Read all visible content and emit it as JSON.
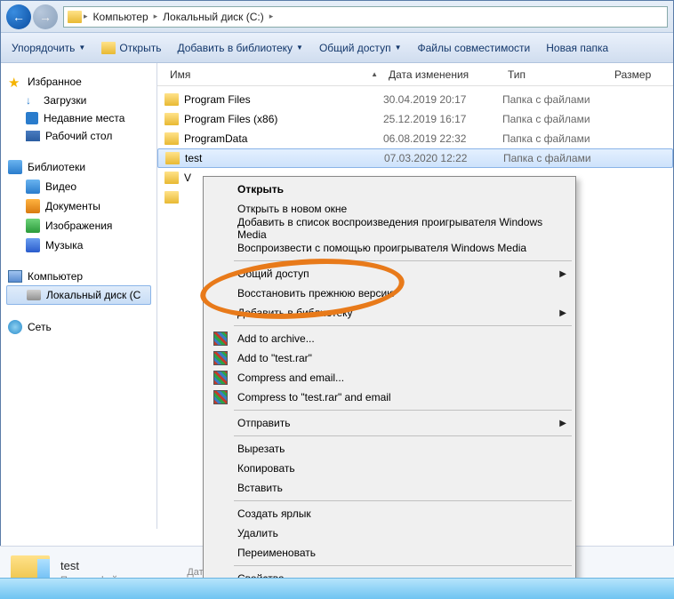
{
  "breadcrumb": {
    "computer": "Компьютер",
    "drive": "Локальный диск (C:)"
  },
  "toolbar": {
    "organize": "Упорядочить",
    "open": "Открыть",
    "add_lib": "Добавить в библиотеку",
    "share": "Общий доступ",
    "compat": "Файлы совместимости",
    "newfolder": "Новая папка"
  },
  "sidebar": {
    "favorites": "Избранное",
    "downloads": "Загрузки",
    "recent": "Недавние места",
    "desktop": "Рабочий стол",
    "libraries": "Библиотеки",
    "video": "Видео",
    "documents": "Документы",
    "images": "Изображения",
    "music": "Музыка",
    "computer": "Компьютер",
    "localdisk": "Локальный диск (C",
    "network": "Сеть"
  },
  "columns": {
    "name": "Имя",
    "date": "Дата изменения",
    "type": "Тип",
    "size": "Размер"
  },
  "files": [
    {
      "name": "Program Files",
      "date": "30.04.2019 20:17",
      "type": "Папка с файлами"
    },
    {
      "name": "Program Files (x86)",
      "date": "25.12.2019 16:17",
      "type": "Папка с файлами"
    },
    {
      "name": "ProgramData",
      "date": "06.08.2019 22:32",
      "type": "Папка с файлами"
    },
    {
      "name": "test",
      "date": "07.03.2020 12:22",
      "type": "Папка с файлами"
    },
    {
      "name": "V",
      "date": "",
      "type": ""
    },
    {
      "name": "",
      "date": "",
      "type": ""
    }
  ],
  "details": {
    "title": "test",
    "type": "Папка с файлами",
    "datelabel": "Дат"
  },
  "context": {
    "open": "Открыть",
    "open_new": "Открыть в новом окне",
    "add_playlist": "Добавить в список воспроизведения проигрывателя Windows Media",
    "play_wmp": "Воспроизвести с помощью проигрывателя Windows Media",
    "share": "Общий доступ",
    "restore": "Восстановить прежнюю версию",
    "add_lib": "Добавить в библиотеку",
    "add_archive": "Add to archive...",
    "add_testrar": "Add to \"test.rar\"",
    "compress_email": "Compress and email...",
    "compress_testrar": "Compress to \"test.rar\" and email",
    "send": "Отправить",
    "cut": "Вырезать",
    "copy": "Копировать",
    "paste": "Вставить",
    "shortcut": "Создать ярлык",
    "delete": "Удалить",
    "rename": "Переименовать",
    "properties": "Свойства"
  }
}
